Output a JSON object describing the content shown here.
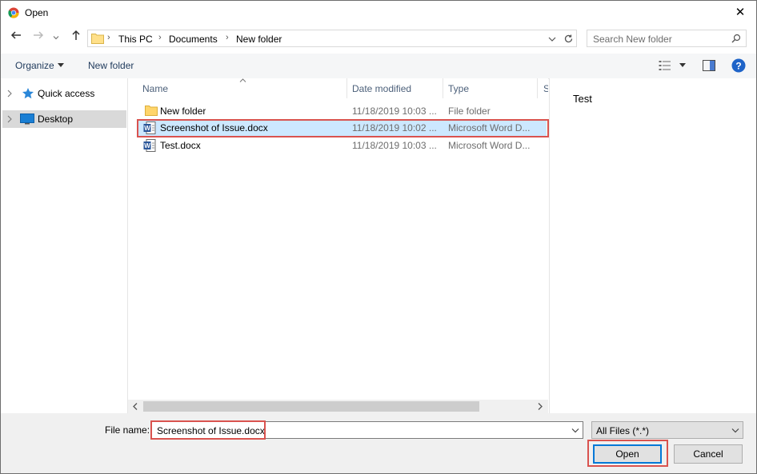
{
  "window": {
    "title": "Open"
  },
  "address": {
    "crumbs": [
      "This PC",
      "Documents",
      "New folder"
    ]
  },
  "search": {
    "placeholder": "Search New folder"
  },
  "toolbar": {
    "organize_label": "Organize",
    "new_folder_label": "New folder"
  },
  "navpane": {
    "items": [
      {
        "label": "Quick access",
        "icon": "star-icon"
      },
      {
        "label": "Desktop",
        "icon": "desktop-icon",
        "selected": true
      }
    ]
  },
  "columns": {
    "name": "Name",
    "date": "Date modified",
    "type": "Type",
    "extra": "S"
  },
  "files": [
    {
      "name": "New folder",
      "date": "11/18/2019 10:03 ...",
      "type": "File folder",
      "icon": "folder-icon"
    },
    {
      "name": "Screenshot of Issue.docx",
      "date": "11/18/2019 10:02 ...",
      "type": "Microsoft Word D...",
      "icon": "word-doc-icon",
      "selected": true
    },
    {
      "name": "Test.docx",
      "date": "11/18/2019 10:03 ...",
      "type": "Microsoft Word D...",
      "icon": "word-doc-icon"
    }
  ],
  "preview": {
    "text": "Test"
  },
  "bottom": {
    "file_name_label": "File name:",
    "file_name_value": "Screenshot of Issue.docx",
    "filter_value": "All Files (*.*)",
    "open_label": "Open",
    "cancel_label": "Cancel"
  },
  "colors": {
    "accent": "#0078d7",
    "highlight": "#d9534f",
    "selection": "#cce8ff"
  }
}
